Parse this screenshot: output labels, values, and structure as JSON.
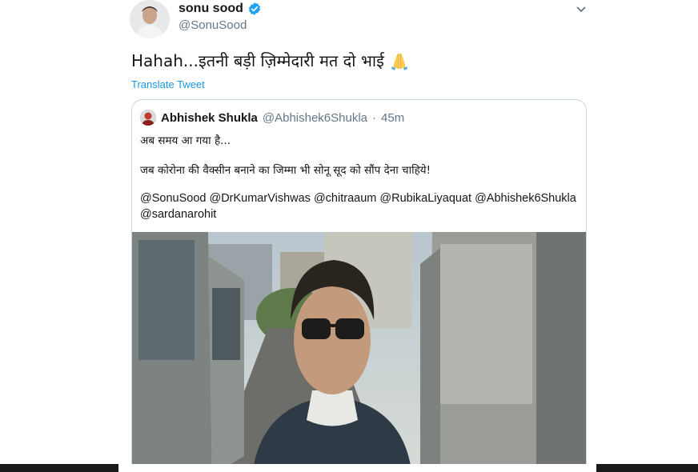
{
  "tweet": {
    "display_name": "sonu sood",
    "handle": "@SonuSood",
    "text": "Hahah...इतनी बड़ी ज़िम्मेदारी मत दो भाई",
    "translate_label": "Translate Tweet",
    "icons": {
      "avatar": "profile-photo",
      "verified": "verified-badge-icon",
      "menu": "chevron-down-icon",
      "emoji": "folded-hands-emoji"
    },
    "colors": {
      "link": "#1b95e0",
      "secondary_text": "#657786",
      "verified": "#1da1f2"
    }
  },
  "quoted_tweet": {
    "display_name": "Abhishek Shukla",
    "handle": "@Abhishek6Shukla",
    "separator": "·",
    "time": "45m",
    "line1": "अब समय आ गया है...",
    "line2": "जब कोरोना की वैक्सीन बनाने का जिम्मा भी सोनू सूद को सौंप देना चाहिये!",
    "mentions": "@SonuSood @DrKumarVishwas @chitraaum @RubikaLiyaquat @Abhishek6Shukla @sardanarohit",
    "media": "photo"
  }
}
